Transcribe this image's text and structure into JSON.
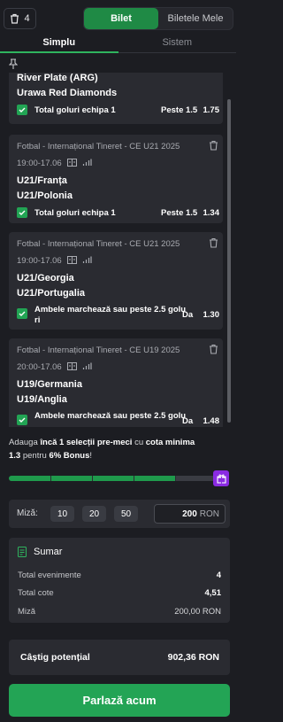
{
  "topbar": {
    "trash_count": "4",
    "toggle": {
      "active": "Bilet",
      "inactive": "Biletele Mele"
    }
  },
  "tabs": {
    "active": "Simplu",
    "inactive": "Sistem"
  },
  "bets": [
    {
      "league": "",
      "time": "",
      "home": "River Plate (ARG)",
      "away": "Urawa Red Diamonds",
      "market": "Total goluri echipa 1",
      "pick": "Peste 1.5",
      "odd": "1.75"
    },
    {
      "league": "Fotbal - Internațional Tineret - CE U21 2025",
      "time": "19:00-17.06",
      "home": "U21/Franța",
      "away": "U21/Polonia",
      "market": "Total goluri echipa 1",
      "pick": "Peste 1.5",
      "odd": "1.34"
    },
    {
      "league": "Fotbal - Internațional Tineret - CE U21 2025",
      "time": "19:00-17.06",
      "home": "U21/Georgia",
      "away": "U21/Portugalia",
      "market_line1": "Ambele marchează sau peste 2.5 golu",
      "market_line2": "ri",
      "pick": "Da",
      "odd": "1.30"
    },
    {
      "league": "Fotbal - Internațional Tineret - CE U19 2025",
      "time": "20:00-17.06",
      "home": "U19/Germania",
      "away": "U19/Anglia",
      "market_line1": "Ambele marchează sau peste 2.5 golu",
      "pick": "Da",
      "odd": "1.48"
    }
  ],
  "bonus": {
    "t1": "Adauga ",
    "b1": "încă 1 selecții pre-meci",
    "t2": " cu ",
    "b2": "cota minima",
    "b3": "1.3",
    "t3": " pentru ",
    "b4": "6% Bonus",
    "t4": "!",
    "progress_fraction": 0.8
  },
  "stake": {
    "label": "Miză:",
    "chips": [
      "10",
      "20",
      "50"
    ],
    "amount": "200",
    "currency": "RON"
  },
  "summary": {
    "title": "Sumar",
    "events_label": "Total evenimente",
    "events_value": "4",
    "odds_label": "Total cote",
    "odds_value": "4,51",
    "stake_label": "Miză",
    "stake_value": "200,00 RON"
  },
  "potential": {
    "label": "Câștig potențial",
    "value": "902,36 RON"
  },
  "cta": {
    "label": "Parlază acum"
  },
  "colors": {
    "accent_green": "#23a455",
    "bonus_purple": "#8a2be2",
    "background": "#1c1d22",
    "card": "#2a2b31"
  }
}
